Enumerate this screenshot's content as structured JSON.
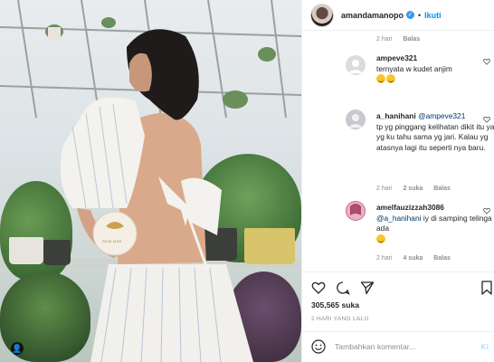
{
  "header": {
    "username": "amandamanopo",
    "follow_label": "Ikuti",
    "separator": "•"
  },
  "comments": [
    {
      "meta": {
        "time": "2 hari",
        "reply": "Balas"
      }
    },
    {
      "username": "ampeve321",
      "text": "ternyata w kudet anjim",
      "emojis": [
        "grinning-sweat-emoji",
        "grinning-sweat-emoji"
      ],
      "avatar_color": "#dcdcdc",
      "meta": {
        "time": "2 hari",
        "likes": "",
        "reply": "Balas"
      }
    },
    {
      "username": "a_hanihani",
      "mention": "@ampeve321",
      "text": "tp yg pinggang kelihatan dikit itu ya kak yg ku tahu sama yg jari. Kalau yg atasnya lagi itu seperti nya baru.",
      "avatar_color": "#c9c8cf",
      "meta": {
        "time": "2 hari",
        "likes": "2 suka",
        "reply": "Balas"
      }
    },
    {
      "username": "amelfauzizzah3086",
      "mention": "@a_hanihani",
      "text": "iy di samping telinga juga ada",
      "emojis": [
        "grinning-emoji"
      ],
      "avatar_color": "#c96a8a",
      "meta": {
        "time": "2 hari",
        "likes": "4 suka",
        "reply": "Balas"
      }
    }
  ],
  "post": {
    "likes_count": "305,565 suka",
    "time_ago": "2 HARI YANG LALU",
    "comment_placeholder": "Tambahkan komentar...",
    "post_label": "Ki"
  },
  "photo": {
    "jar_brand": "SKIN MINI"
  },
  "colors": {
    "accent": "#0095f6",
    "verified": "#3897f0",
    "muted": "#8e8e8e",
    "text": "#262626",
    "mention": "#00376b"
  },
  "icons": [
    "verified-badge-icon",
    "heart-icon",
    "comment-icon",
    "share-icon",
    "bookmark-icon",
    "smiley-icon",
    "tag-person-icon"
  ]
}
